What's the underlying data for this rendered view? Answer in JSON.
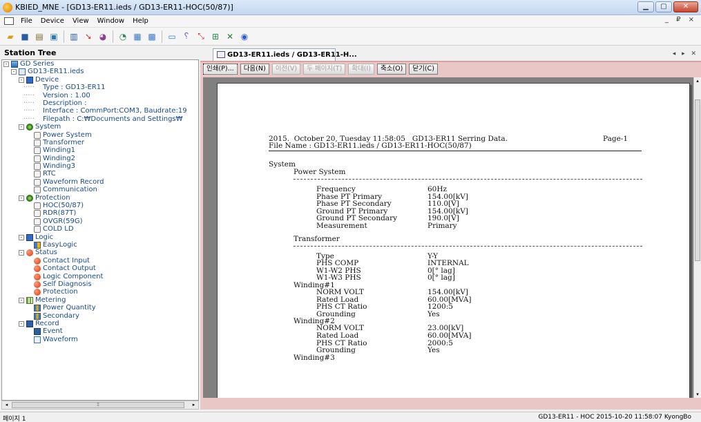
{
  "window": {
    "title": "KBIED_MNE - [GD13-ER11.ieds / GD13-ER11-HOC(50/87)]"
  },
  "menu": {
    "items": [
      "File",
      "Device",
      "View",
      "Window",
      "Help"
    ],
    "mdi_controls": "_ ₽ ×"
  },
  "tree": {
    "header": "Station Tree",
    "rows": [
      {
        "label": "GD Series",
        "indent": 0,
        "icon": "ico-db",
        "exp": "-"
      },
      {
        "label": "GD13-ER11.ieds",
        "indent": 1,
        "icon": "ico-file",
        "exp": "-"
      },
      {
        "label": "Device",
        "indent": 2,
        "icon": "ico-dev",
        "exp": "-"
      },
      {
        "label": "Type : GD13-ER11",
        "indent": 3,
        "icon": "",
        "exp": ""
      },
      {
        "label": "Version : 1.00",
        "indent": 3,
        "icon": "",
        "exp": ""
      },
      {
        "label": "Description :",
        "indent": 3,
        "icon": "",
        "exp": ""
      },
      {
        "label": "Interface : CommPort:COM3, Baudrate:19",
        "indent": 3,
        "icon": "",
        "exp": ""
      },
      {
        "label": "Filepath : C:₩Documents and Settings₩",
        "indent": 3,
        "icon": "",
        "exp": ""
      },
      {
        "label": "System",
        "indent": 2,
        "icon": "ico-gear",
        "exp": "-"
      },
      {
        "label": "Power System",
        "indent": 3,
        "icon": "ico-wave",
        "exp": ""
      },
      {
        "label": "Transformer",
        "indent": 3,
        "icon": "ico-wave",
        "exp": ""
      },
      {
        "label": "Winding1",
        "indent": 3,
        "icon": "ico-wave",
        "exp": ""
      },
      {
        "label": "Winding2",
        "indent": 3,
        "icon": "ico-wave",
        "exp": ""
      },
      {
        "label": "Winding3",
        "indent": 3,
        "icon": "ico-wave",
        "exp": ""
      },
      {
        "label": "RTC",
        "indent": 3,
        "icon": "ico-wave",
        "exp": ""
      },
      {
        "label": "Waveform Record",
        "indent": 3,
        "icon": "ico-wave",
        "exp": ""
      },
      {
        "label": "Communication",
        "indent": 3,
        "icon": "ico-wave",
        "exp": ""
      },
      {
        "label": "Protection",
        "indent": 2,
        "icon": "ico-gear",
        "exp": "-"
      },
      {
        "label": "HOC(50/87)",
        "indent": 3,
        "icon": "ico-wave",
        "exp": ""
      },
      {
        "label": "RDR(87T)",
        "indent": 3,
        "icon": "ico-wave",
        "exp": ""
      },
      {
        "label": "OVGR(59G)",
        "indent": 3,
        "icon": "ico-wave",
        "exp": ""
      },
      {
        "label": "COLD LD",
        "indent": 3,
        "icon": "ico-wave",
        "exp": ""
      },
      {
        "label": "Logic",
        "indent": 2,
        "icon": "ico-dev",
        "exp": "-"
      },
      {
        "label": "EasyLogic",
        "indent": 3,
        "icon": "ico-logic",
        "exp": ""
      },
      {
        "label": "Status",
        "indent": 2,
        "icon": "ico-red",
        "exp": "-"
      },
      {
        "label": "Contact Input",
        "indent": 3,
        "icon": "ico-red",
        "exp": ""
      },
      {
        "label": "Contact Output",
        "indent": 3,
        "icon": "ico-red",
        "exp": ""
      },
      {
        "label": "Logic Component",
        "indent": 3,
        "icon": "ico-red",
        "exp": ""
      },
      {
        "label": "Self Diagnosis",
        "indent": 3,
        "icon": "ico-red",
        "exp": ""
      },
      {
        "label": "Protection",
        "indent": 3,
        "icon": "ico-red",
        "exp": ""
      },
      {
        "label": "Metering",
        "indent": 2,
        "icon": "ico-grid",
        "exp": "-"
      },
      {
        "label": "Power Quantity",
        "indent": 3,
        "icon": "ico-bar",
        "exp": ""
      },
      {
        "label": "Secondary",
        "indent": 3,
        "icon": "ico-bar",
        "exp": ""
      },
      {
        "label": "Record",
        "indent": 2,
        "icon": "ico-rec",
        "exp": "-"
      },
      {
        "label": "Event",
        "indent": 3,
        "icon": "ico-rec",
        "exp": ""
      },
      {
        "label": "Waveform",
        "indent": 3,
        "icon": "ico-wf",
        "exp": ""
      }
    ]
  },
  "tab": {
    "label": "GD13-ER11.ieds / GD13-ER11-H..."
  },
  "preview_toolbar": {
    "buttons": [
      {
        "label": "인쇄(P)...",
        "enabled": true
      },
      {
        "label": "다음(N)",
        "enabled": true
      },
      {
        "label": "이전(V)",
        "enabled": false
      },
      {
        "label": "두 페이지(T)",
        "enabled": false
      },
      {
        "label": "확대(I)",
        "enabled": false
      },
      {
        "label": "축소(O)",
        "enabled": true
      },
      {
        "label": "닫기(C)",
        "enabled": true
      }
    ]
  },
  "report": {
    "header_line1": "2015.  October 20, Tuesday 11:58:05   GD13-ER11 Serring Data.",
    "header_page": "Page-1",
    "header_line2": "File Name : GD13-ER11.ieds / GD13-ER11-HOC(50/87)",
    "section": "System",
    "power_system": {
      "title": "Power System",
      "rows": [
        [
          "Frequency",
          "60Hz"
        ],
        [
          "Phase PT Primary",
          "154.00[kV]"
        ],
        [
          "Phase PT Secondary",
          "110.0[V]"
        ],
        [
          "Ground PT Primary",
          "154.00[kV]"
        ],
        [
          "Ground PT Secondary",
          "190.0[V]"
        ],
        [
          "Measurement",
          "Primary"
        ]
      ]
    },
    "transformer": {
      "title": "Transformer",
      "rows": [
        [
          "Type",
          "Y-Y"
        ],
        [
          "PHS COMP",
          "INTERNAL"
        ],
        [
          "W1-W2 PHS",
          "0[° lag]"
        ],
        [
          "W1-W3 PHS",
          "0[° lag]"
        ]
      ]
    },
    "winding1": {
      "title": "Winding#1",
      "rows": [
        [
          "NORM VOLT",
          "154.00[kV]"
        ],
        [
          "Rated Load",
          "60.00[MVA]"
        ],
        [
          "PHS CT Ratio",
          "1200:5"
        ],
        [
          "Grounding",
          "Yes"
        ]
      ]
    },
    "winding2": {
      "title": "Winding#2",
      "rows": [
        [
          "NORM VOLT",
          "23.00[kV]"
        ],
        [
          "Rated Load",
          "60.00[MVA]"
        ],
        [
          "PHS CT Ratio",
          "2000:5"
        ],
        [
          "Grounding",
          "Yes"
        ]
      ]
    },
    "winding3": {
      "title": "Winding#3"
    }
  },
  "status": {
    "left": "페이지 1",
    "right": "GD13-ER11 - HOC  2015-10-20 11:58:07  KyongBo"
  }
}
